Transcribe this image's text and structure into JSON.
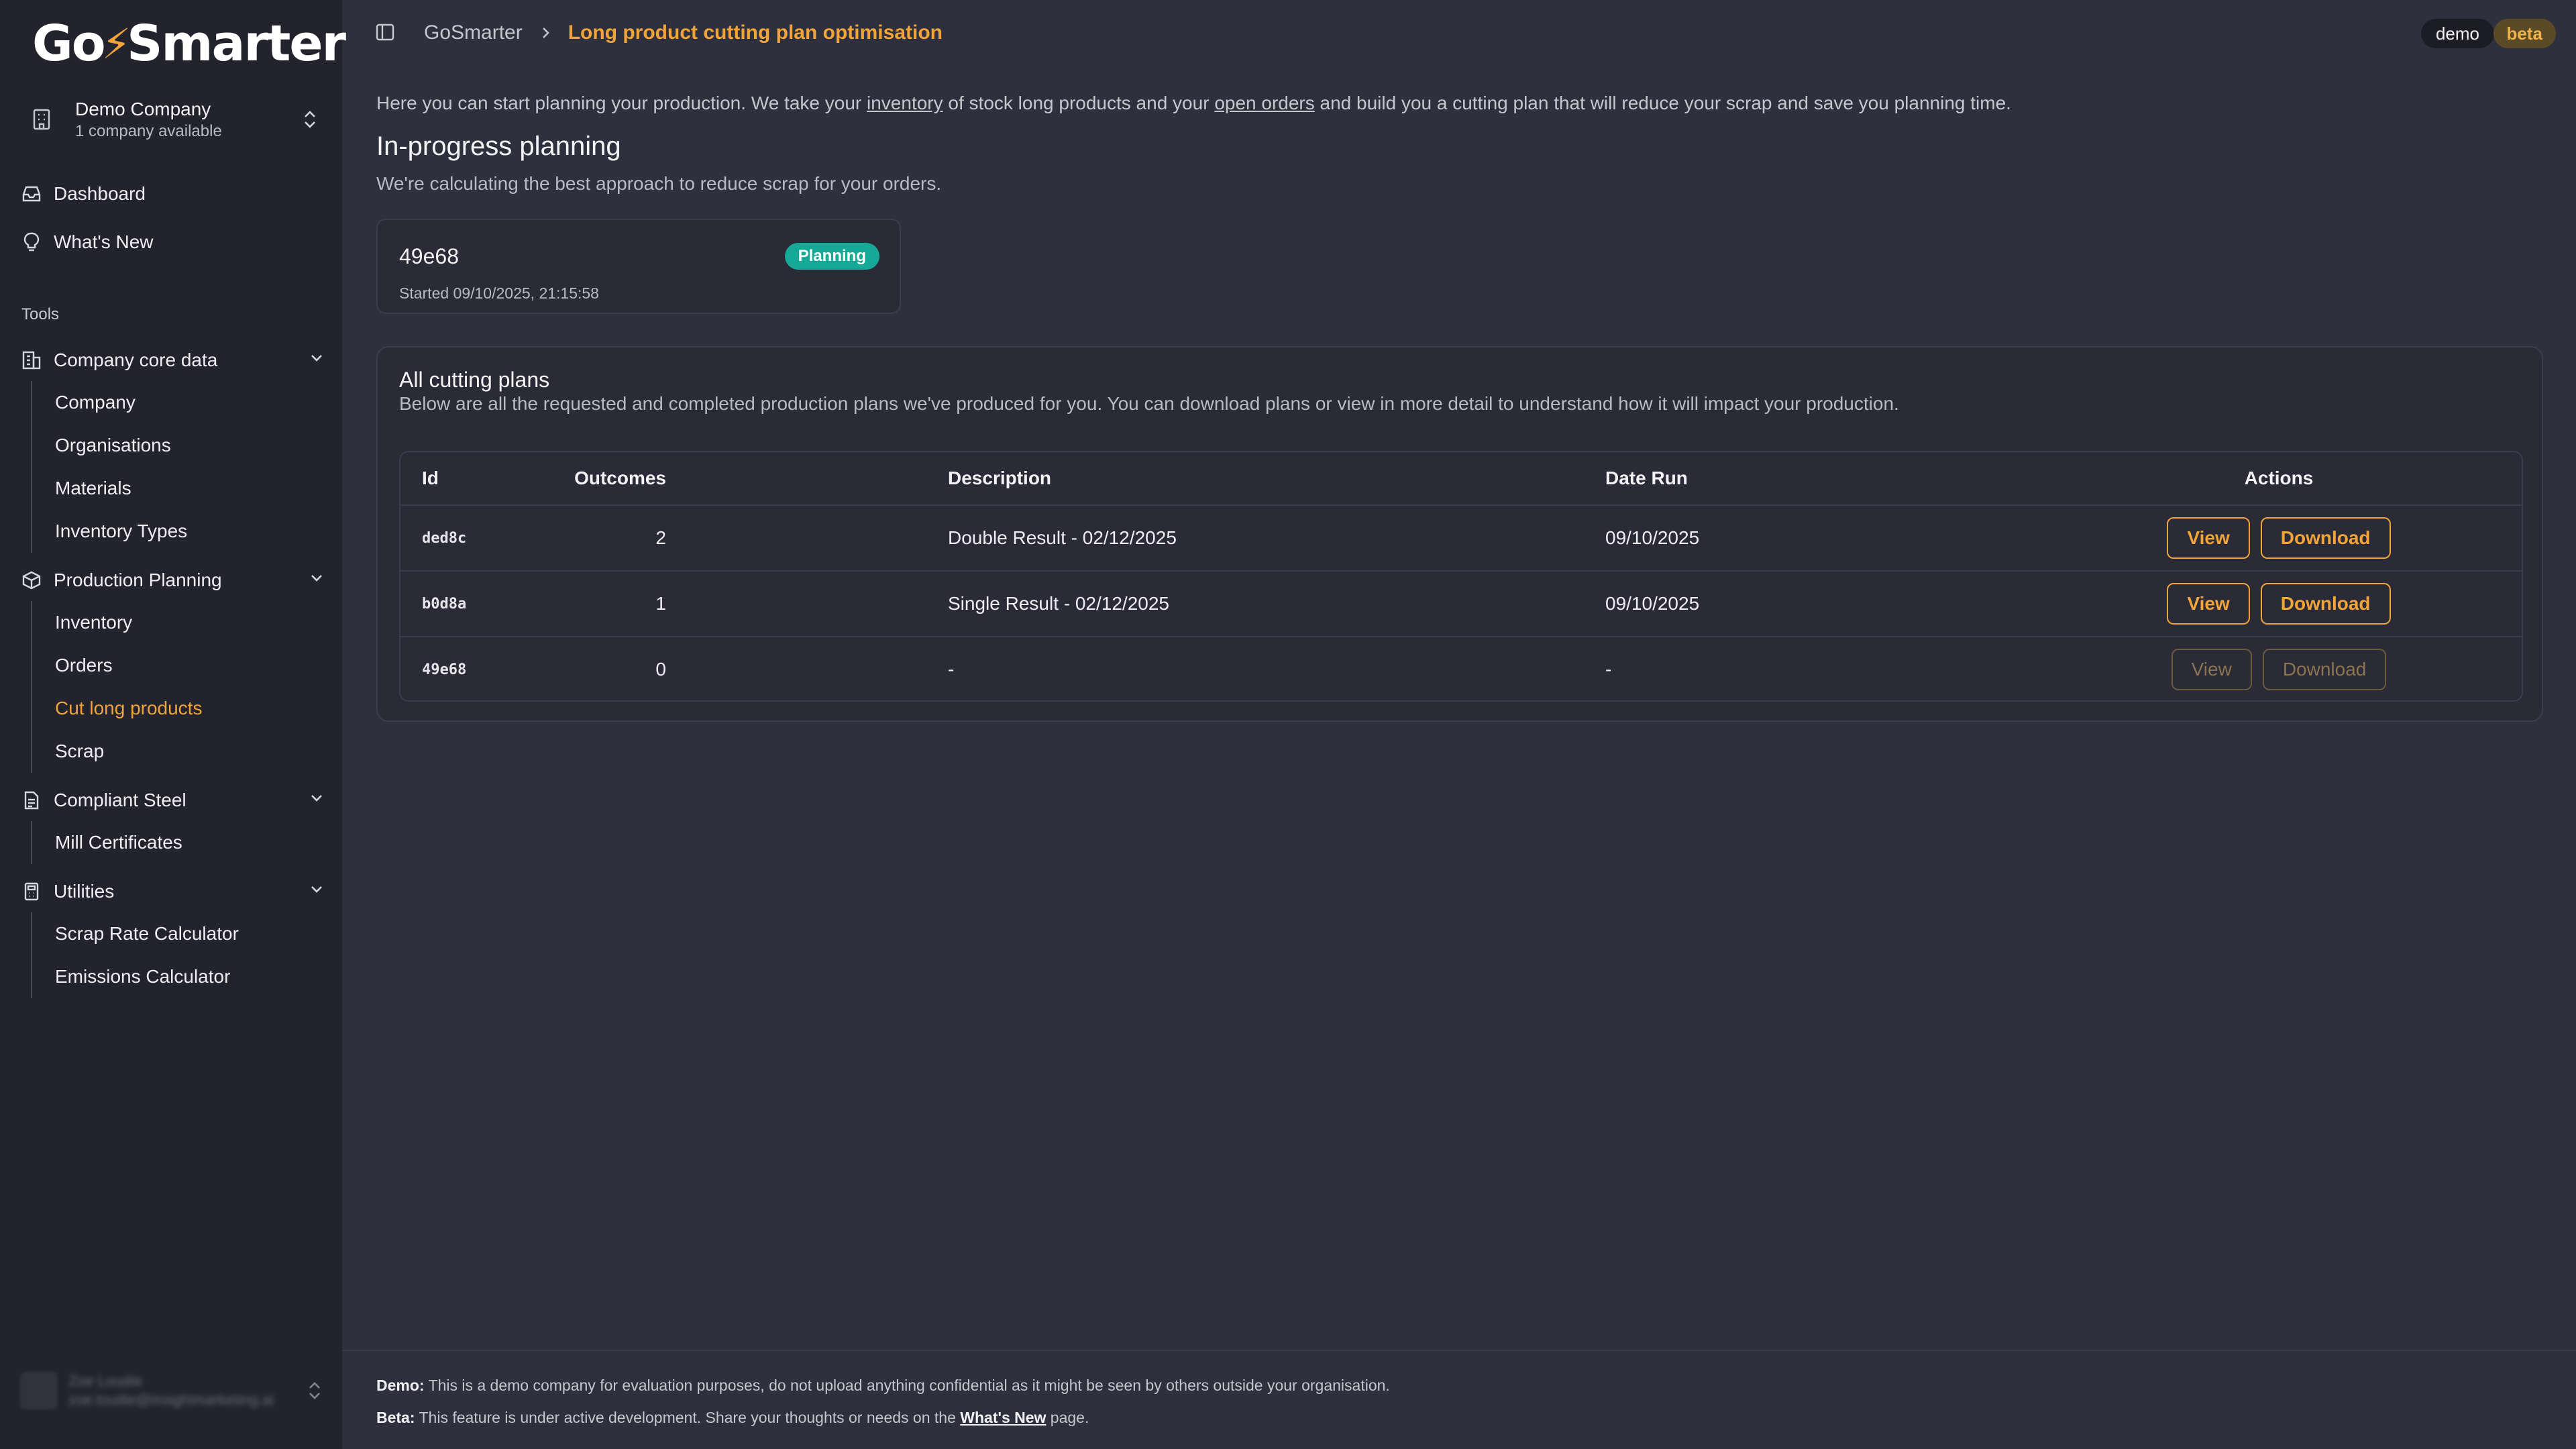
{
  "app": {
    "logo_prefix": "Go",
    "logo_suffix": "Smarter"
  },
  "company": {
    "name": "Demo Company",
    "sub": "1 company available"
  },
  "nav": {
    "dashboard": "Dashboard",
    "whats_new": "What's New",
    "tools_label": "Tools",
    "core_data": {
      "label": "Company core data",
      "items": [
        "Company",
        "Organisations",
        "Materials",
        "Inventory Types"
      ]
    },
    "production": {
      "label": "Production Planning",
      "items": [
        "Inventory",
        "Orders",
        "Cut long products",
        "Scrap"
      ]
    },
    "compliant": {
      "label": "Compliant Steel",
      "items": [
        "Mill Certificates"
      ]
    },
    "utilities": {
      "label": "Utilities",
      "items": [
        "Scrap Rate Calculator",
        "Emissions Calculator"
      ]
    }
  },
  "user": {
    "name": "Zoe Loudie",
    "email": "zoe.loudie@insightmarketing.ai"
  },
  "breadcrumb": {
    "root": "GoSmarter",
    "current": "Long product cutting plan optimisation"
  },
  "badges": {
    "demo": "demo",
    "beta": "beta"
  },
  "intro": {
    "part1": "Here you can start planning your production. We take your ",
    "link1": "inventory",
    "part2": " of stock long products and your ",
    "link2": "open orders",
    "part3": " and build you a cutting plan that will reduce your scrap and save you planning time."
  },
  "in_progress": {
    "title": "In-progress planning",
    "subtitle": "We're calculating the best approach to reduce scrap for your orders.",
    "card": {
      "id": "49e68",
      "status": "Planning",
      "started": "Started 09/10/2025, 21:15:58"
    }
  },
  "plans": {
    "title": "All cutting plans",
    "description": "Below are all the requested and completed production plans we've produced for you. You can download plans or view in more detail to understand how it will impact your production.",
    "columns": {
      "id": "Id",
      "outcomes": "Outcomes",
      "description": "Description",
      "date_run": "Date Run",
      "actions": "Actions"
    },
    "rows": [
      {
        "id": "ded8c",
        "outcomes": "2",
        "description": "Double Result - 02/12/2025",
        "date_run": "09/10/2025",
        "view": "View",
        "download": "Download"
      },
      {
        "id": "b0d8a",
        "outcomes": "1",
        "description": "Single Result - 02/12/2025",
        "date_run": "09/10/2025",
        "view": "View",
        "download": "Download"
      },
      {
        "id": "49e68",
        "outcomes": "0",
        "description": "-",
        "date_run": "-",
        "view": "View",
        "download": "Download"
      }
    ]
  },
  "footer": {
    "demo_label": "Demo:",
    "demo_text": " This is a demo company for evaluation purposes, do not upload anything confidential as it might be seen by others outside your organisation.",
    "beta_label": "Beta:",
    "beta_text_1": " This feature is under active development. Share your thoughts or needs on the ",
    "beta_link": "What's New",
    "beta_text_2": " page."
  },
  "colors": {
    "accent": "#f0a43a",
    "status_planning": "#16a998",
    "sidebar_bg": "#22232c",
    "main_bg": "#2f303d"
  }
}
